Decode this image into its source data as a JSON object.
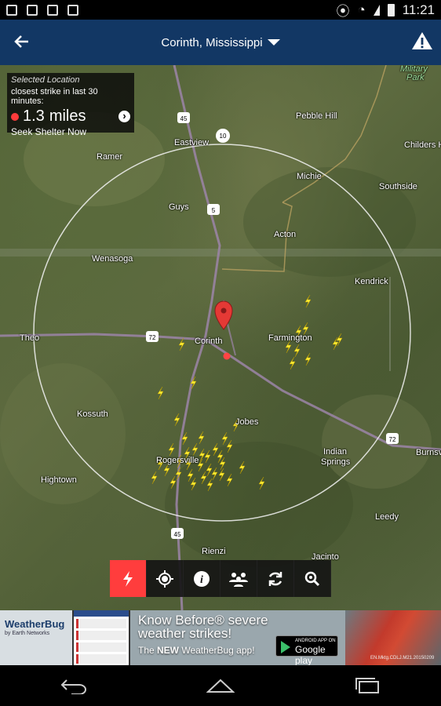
{
  "status_bar": {
    "time": "11:21"
  },
  "app_bar": {
    "location": "Corinth, Mississippi"
  },
  "info_panel": {
    "heading": "Selected Location",
    "subheading": "closest strike in last 30 minutes:",
    "distance_value": "1.3",
    "distance_unit": "miles",
    "action": "Seek Shelter Now"
  },
  "map": {
    "places": [
      {
        "name": "Military",
        "park": true
      },
      {
        "name": "Park",
        "park": true
      },
      {
        "name": "Pebble Hill"
      },
      {
        "name": "Childers H"
      },
      {
        "name": "Eastview"
      },
      {
        "name": "Ramer"
      },
      {
        "name": "Michie"
      },
      {
        "name": "Southside"
      },
      {
        "name": "Guys"
      },
      {
        "name": "Acton"
      },
      {
        "name": "Wenasoga"
      },
      {
        "name": "Kendrick"
      },
      {
        "name": "Theo"
      },
      {
        "name": "Corinth"
      },
      {
        "name": "Farmington"
      },
      {
        "name": "Kossuth"
      },
      {
        "name": "Jobes"
      },
      {
        "name": "Rogersville"
      },
      {
        "name": "Indian"
      },
      {
        "name": "Springs"
      },
      {
        "name": "Burnsv"
      },
      {
        "name": "Hightown"
      },
      {
        "name": "Leedy"
      },
      {
        "name": "Rienzi"
      },
      {
        "name": "Jacinto"
      }
    ],
    "road_shields": [
      "45",
      "10",
      "5",
      "72",
      "72",
      "45"
    ]
  },
  "toolbar": {
    "tools": [
      "lightning-icon",
      "locate-icon",
      "info-icon",
      "people-icon",
      "refresh-icon",
      "zoom-icon"
    ],
    "active": "lightning-icon",
    "accent": "#ff3d3d"
  },
  "ad": {
    "brand": "WeatherBug",
    "brand_sub": "by Earth Networks",
    "headline_1": "Know Before® severe",
    "headline_2": "weather strikes!",
    "tagline_1": "The ",
    "tagline_new": "NEW",
    "tagline_2": " WeatherBug app!",
    "store_small": "ANDROID APP ON",
    "store_big": "Google play",
    "fine_print": "EN.Mktg.CDLJ.M21.20150209"
  },
  "colors": {
    "app_bar": "#123764",
    "strike": "#ffee33",
    "pin": "#e53935"
  }
}
